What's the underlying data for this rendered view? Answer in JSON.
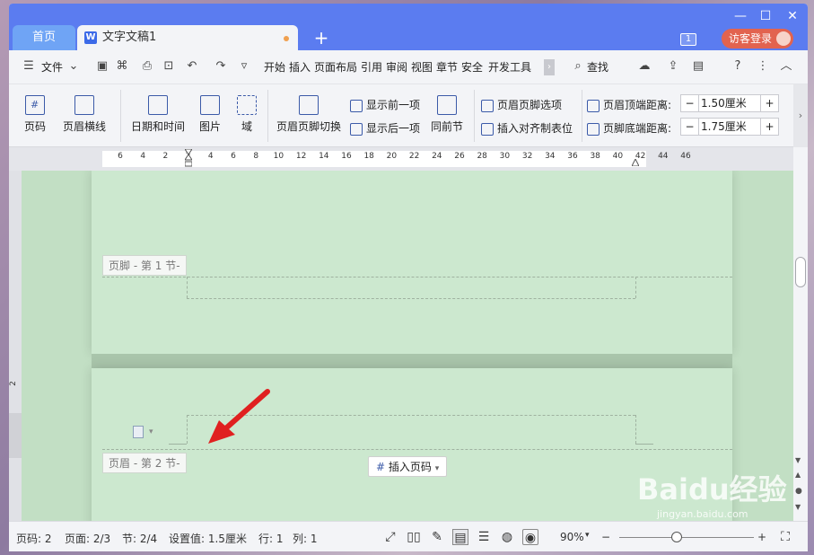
{
  "titlebar": {
    "home_tab": "首页",
    "doc_tab": "文字文稿1",
    "add_tab": "+",
    "badge": "1",
    "login": "访客登录",
    "win_min": "—",
    "win_max": "☐",
    "win_close": "✕"
  },
  "menubar": {
    "file": "文件",
    "items": [
      "开始",
      "插入",
      "页面布局",
      "引用",
      "审阅",
      "视图",
      "章节",
      "安全",
      "开发工具"
    ],
    "search": "查找"
  },
  "ribbon": {
    "page_number": "页码",
    "header_line": "页眉横线",
    "date_time": "日期和时间",
    "picture": "图片",
    "field": "域",
    "hf_switch": "页眉页脚切换",
    "show_prev": "显示前一项",
    "show_next": "显示后一项",
    "same_as_prev": "同前节",
    "hf_options": "页眉页脚选项",
    "insert_align_tab": "插入对齐制表位",
    "header_top_label": "页眉顶端距离:",
    "header_top_value": "1.50厘米",
    "footer_bottom_label": "页脚底端距离:",
    "footer_bottom_value": "1.75厘米",
    "minus": "−",
    "plus": "+"
  },
  "ruler": {
    "ticks": [
      "6",
      "4",
      "2",
      "2",
      "4",
      "6",
      "8",
      "10",
      "12",
      "14",
      "16",
      "18",
      "20",
      "22",
      "24",
      "26",
      "28",
      "30",
      "32",
      "34",
      "36",
      "38",
      "40",
      "42",
      "44",
      "46"
    ]
  },
  "document": {
    "footer_label": "页脚  - 第 1 节-",
    "header_label": "页眉  - 第 2 节-",
    "insert_page_number": "插入页码"
  },
  "statusbar": {
    "page_code": "页码: 2",
    "page": "页面: 2/3",
    "section": "节: 2/4",
    "setting": "设置值: 1.5厘米",
    "row": "行: 1",
    "col": "列: 1",
    "zoom": "90%"
  },
  "watermark": {
    "brand": "Baidu经验",
    "url": "jingyan.baidu.com"
  },
  "colors": {
    "titlebar": "#5b7cf0",
    "page_bg": "#cce8cf",
    "arrow": "#e02020"
  }
}
